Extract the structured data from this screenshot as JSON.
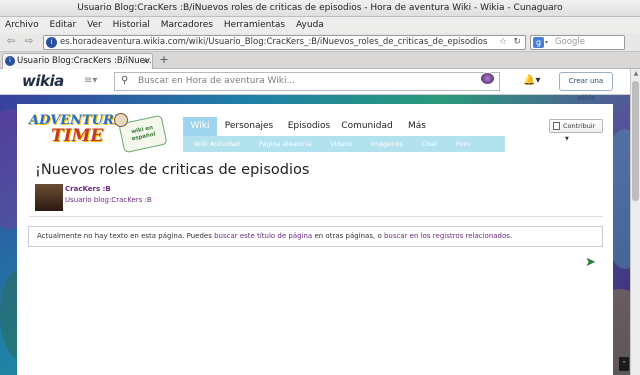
{
  "window": {
    "title": "Usuario Blog:CracKers :B/iNuevos roles de criticas de episodios - Hora de aventura Wiki - Wikia - Cunaguaro"
  },
  "menu": [
    "Archivo",
    "Editar",
    "Ver",
    "Historial",
    "Marcadores",
    "Herramientas",
    "Ayuda"
  ],
  "nav": {
    "back": "⇦",
    "forward": "⇨",
    "url": "es.horadeaventura.wikia.com/wiki/Usuario_Blog:CracKers_:B/iNuevos_roles_de_criticas_de_episodios",
    "search_engine_label": "g",
    "search_placeholder": "Google"
  },
  "tabs": [
    {
      "label": "Usuario Blog:CracKers :B/iNuev..."
    }
  ],
  "wikia": {
    "logo": "wikia",
    "search_placeholder": "Buscar en Hora de aventura Wiki...",
    "create_wiki": "Crear una wikia"
  },
  "wiki": {
    "wordmark_line1": "ADVENTURE",
    "wordmark_line2": "TIME",
    "wordmark_badge": "wiki en español",
    "nav_tabs": [
      "Wiki",
      "Personajes",
      "Episodios",
      "Comunidad",
      "Más"
    ],
    "sub_nav": [
      "Wiki Actividad",
      "Página aleatoria",
      "Videos",
      "Imágenes",
      "Chat",
      "Foro"
    ],
    "contribute": "Contribuir"
  },
  "article": {
    "title": "¡Nuevos roles de criticas de episodios",
    "author": "CracKers :B",
    "author_blog": "Usuario blog:CracKers :B",
    "notice_prefix": "Actualmente no hay texto en esta página. Puedes ",
    "notice_link1": "buscar este título de página",
    "notice_middle": " en otras páginas, o ",
    "notice_link2": "buscar en los registros relacionados",
    "notice_suffix": "."
  },
  "colors": {
    "accent": "#9fd4ee",
    "link": "#6a2b82",
    "wikia_brand": "#202f45"
  }
}
